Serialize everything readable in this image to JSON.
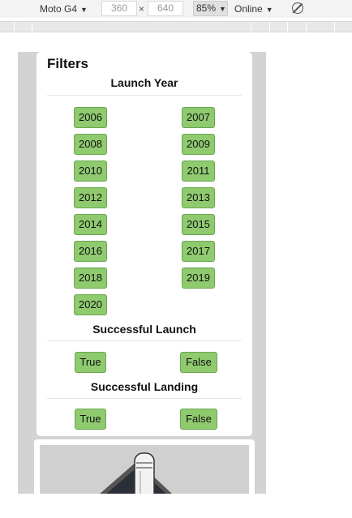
{
  "devtools": {
    "device": "Moto G4",
    "width": "360",
    "height": "640",
    "times": "×",
    "zoom": "85%",
    "network": "Online"
  },
  "filters": {
    "title": "Filters",
    "launch_year": {
      "title": "Launch Year",
      "years": [
        "2006",
        "2007",
        "2008",
        "2009",
        "2010",
        "2011",
        "2012",
        "2013",
        "2014",
        "2015",
        "2016",
        "2017",
        "2018",
        "2019",
        "2020"
      ]
    },
    "successful_launch": {
      "title": "Successful Launch",
      "true_label": "True",
      "false_label": "False"
    },
    "successful_landing": {
      "title": "Successful Landing",
      "true_label": "True",
      "false_label": "False"
    }
  },
  "colors": {
    "button_bg": "#8fca6f",
    "button_border": "#6aa84f",
    "viewport_bg": "#d3d3d3"
  }
}
